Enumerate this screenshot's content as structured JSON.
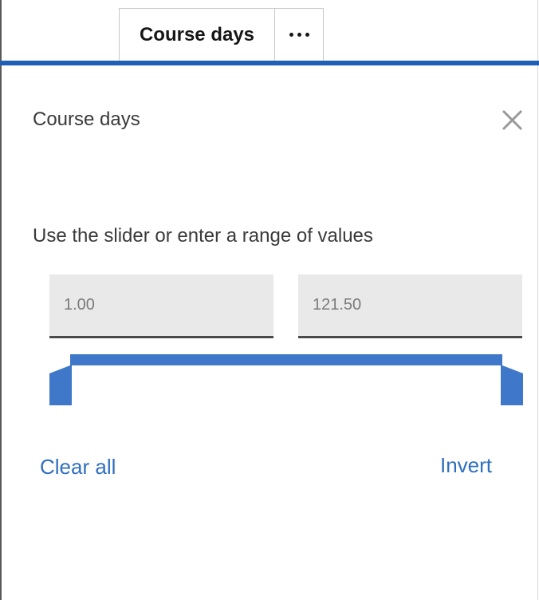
{
  "tab": {
    "title": "Course days",
    "more_icon": "ellipsis-icon"
  },
  "panel": {
    "title": "Course days",
    "close_icon": "close-icon",
    "instructions": "Use the slider or enter a range of values",
    "range": {
      "min_value": "1.00",
      "max_value": "121.50"
    },
    "slider": {
      "low_position": 0,
      "high_position": 1
    },
    "clear_all_label": "Clear all",
    "invert_label": "Invert"
  },
  "colors": {
    "accent": "#1f5fb5",
    "slider": "#3f78c8",
    "link": "#2f6fbe",
    "input_bg": "#e9e9e9"
  }
}
